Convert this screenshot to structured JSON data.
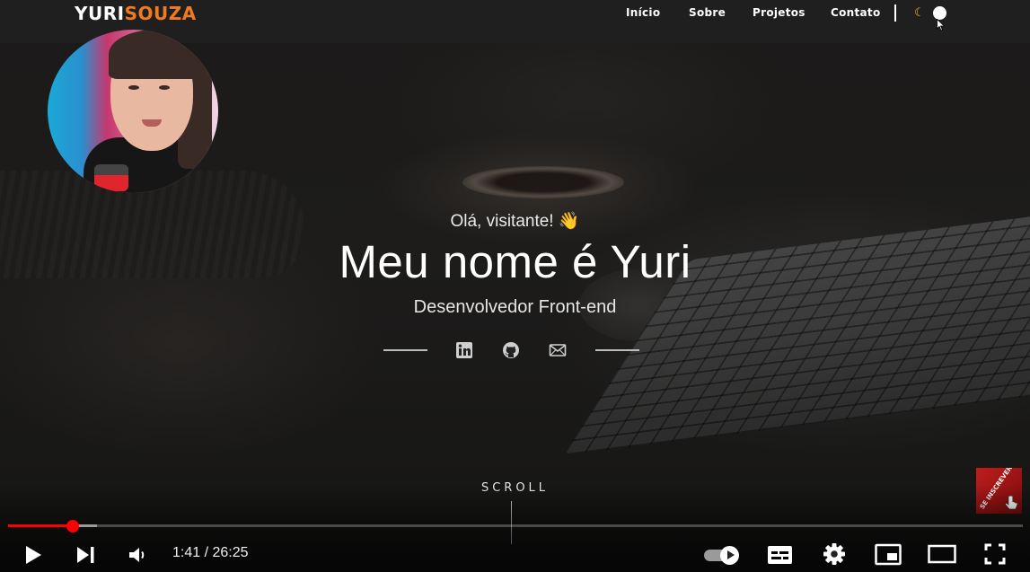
{
  "site": {
    "logo_first": "YURI",
    "logo_second": "SOUZA",
    "nav": [
      {
        "label": "Início"
      },
      {
        "label": "Sobre"
      },
      {
        "label": "Projetos"
      },
      {
        "label": "Contato"
      }
    ],
    "theme_toggle": {
      "icon": "moon-icon",
      "state": "dark"
    }
  },
  "hero": {
    "greeting": "Olá, visitante! 👋",
    "title": "Meu nome é Yuri",
    "subtitle": "Desenvolvedor Front-end",
    "social": [
      "linkedin-icon",
      "github-icon",
      "mail-icon"
    ],
    "scroll_label": "SCROLL"
  },
  "player": {
    "current_time": "1:41",
    "duration": "26:25",
    "time_display": "1:41 / 26:25",
    "played_fraction": 0.064,
    "buffered_fraction": 0.088,
    "subscribe_badge": "SE INSCREVER",
    "colors": {
      "progress": "#ff0000",
      "logo_accent": "#f07a1f",
      "moon": "#f2c100"
    }
  }
}
